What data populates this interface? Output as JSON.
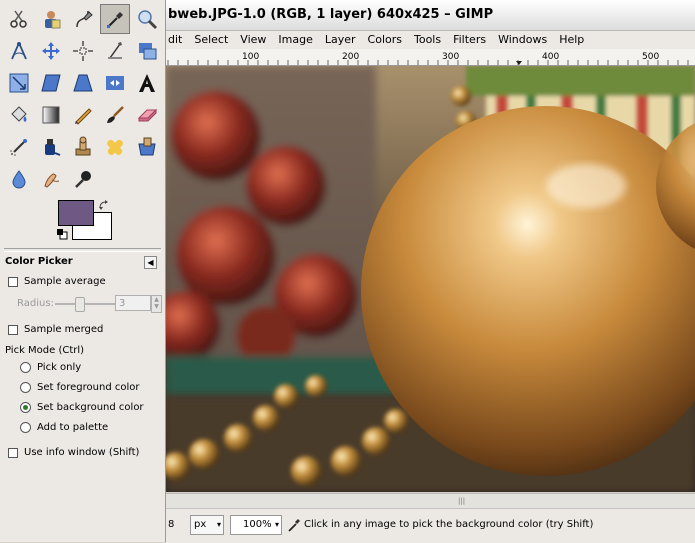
{
  "window_title": "bweb.JPG-1.0 (RGB, 1 layer) 640x425 – GIMP",
  "menu": [
    "dit",
    "Select",
    "View",
    "Image",
    "Layer",
    "Colors",
    "Tools",
    "Filters",
    "Windows",
    "Help"
  ],
  "ruler_h_ticks": [
    "100",
    "200",
    "300",
    "400",
    "500"
  ],
  "toolbox": {
    "tools": [
      "scissors-select-icon",
      "foreground-select-icon",
      "paths-icon",
      "color-picker-icon",
      "magnify-icon",
      "measure-icon",
      "move-icon",
      "align-icon",
      "crop-icon",
      "rotate-icon",
      "scale-icon",
      "shear-icon",
      "perspective-icon",
      "flip-icon",
      "text-icon",
      "bucket-fill-icon",
      "blend-icon",
      "pencil-icon",
      "paintbrush-icon",
      "eraser-icon",
      "airbrush-icon",
      "ink-icon",
      "clone-icon",
      "heal-icon",
      "perspective-clone-icon",
      "blur-sharpen-icon",
      "smudge-icon",
      "dodge-burn-icon"
    ],
    "active_tool": "color-picker-icon",
    "foreground_color": "#6e5884",
    "background_color": "#ffffff"
  },
  "options": {
    "title": "Color Picker",
    "sample_average": "Sample average",
    "radius_label": "Radius:",
    "radius_value": "3",
    "sample_merged": "Sample merged",
    "pick_mode_label": "Pick Mode  (Ctrl)",
    "pick_modes": [
      "Pick only",
      "Set foreground color",
      "Set background color",
      "Add to palette"
    ],
    "selected_pick_mode": 2,
    "use_info_window": "Use info window  (Shift)"
  },
  "status": {
    "coord": "8",
    "unit": "px",
    "zoom": "100%",
    "message": "Click in any image to pick the background color (try Shift)"
  }
}
